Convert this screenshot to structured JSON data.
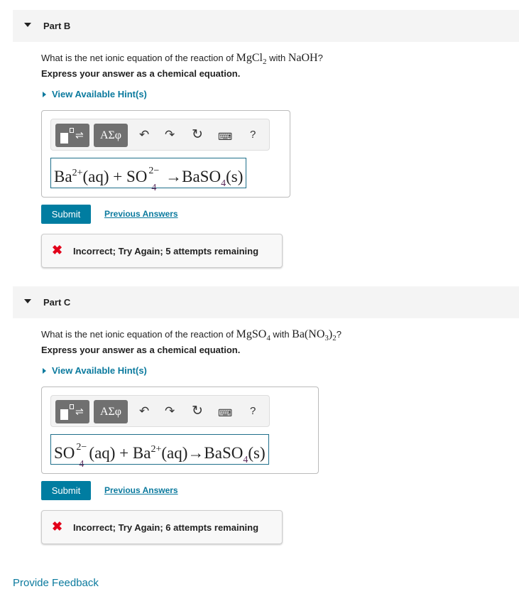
{
  "toolbar": {
    "templates_icon": "templates-icon",
    "symbols_label": "ΑΣφ",
    "undo_icon": "undo-icon",
    "redo_icon": "redo-icon",
    "reset_icon": "reset-icon",
    "keyboard_icon": "keyboard-icon",
    "help_label": "?"
  },
  "parts": [
    {
      "title": "Part B",
      "question_prefix": "What is the net ionic equation of the reaction of ",
      "reactant1": "MgCl",
      "reactant1_sub": "2",
      "with": " with ",
      "reactant2": "NaOH",
      "reactant2_sub": "",
      "qend": "?",
      "express": "Express your answer as a chemical equation.",
      "hint": "View Available Hint(s)",
      "answer": [
        {
          "t": "Ba"
        },
        {
          "sup": "2+"
        },
        {
          "t": "(aq) + SO"
        },
        {
          "ss": [
            "2−",
            "4"
          ]
        },
        {
          "t": " →BaSO"
        },
        {
          "sub": "4"
        },
        {
          "t": "(s)"
        }
      ],
      "submit": "Submit",
      "previous": "Previous Answers",
      "feedback": "Incorrect; Try Again; 5 attempts remaining",
      "feedback_icon": "x-icon"
    },
    {
      "title": "Part C",
      "question_prefix": "What is the net ionic equation of the reaction of ",
      "reactant1": "MgSO",
      "reactant1_sub": "4",
      "with": " with ",
      "reactant2": "Ba(NO",
      "reactant2_sub": "3",
      "reactant2_tail": ")",
      "reactant2_sub2": "2",
      "qend": "?",
      "express": "Express your answer as a chemical equation.",
      "hint": "View Available Hint(s)",
      "answer": [
        {
          "t": "SO"
        },
        {
          "ss": [
            "2−",
            "4"
          ]
        },
        {
          "t": "(aq) + Ba"
        },
        {
          "sup": "2+"
        },
        {
          "t": "(aq)→BaSO"
        },
        {
          "sub": "4"
        },
        {
          "t": "(s)"
        }
      ],
      "submit": "Submit",
      "previous": "Previous Answers",
      "feedback": "Incorrect; Try Again; 6 attempts remaining",
      "feedback_icon": "x-icon"
    }
  ],
  "footer": {
    "feedback_link": "Provide Feedback"
  }
}
